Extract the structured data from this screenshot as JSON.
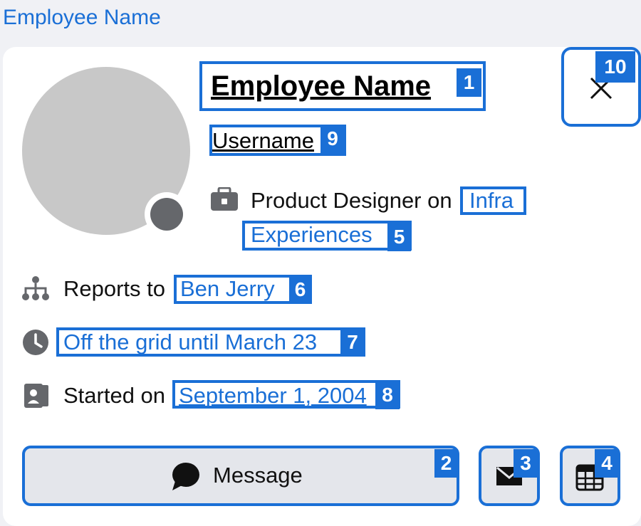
{
  "header": {
    "title_link": "Employee Name"
  },
  "profile": {
    "name": "Employee Name",
    "username": "Username",
    "role_prefix": "Product Designer on",
    "team_line1": "Infra",
    "team_line2": "Experiences",
    "reports_to_label": "Reports to",
    "manager": "Ben Jerry",
    "status": "Off the grid until March 23",
    "started_label": "Started on",
    "start_date": "September 1, 2004"
  },
  "actions": {
    "message_label": "Message"
  },
  "markers": {
    "name": "1",
    "message": "2",
    "email": "3",
    "calendar": "4",
    "team": "5",
    "manager": "6",
    "status": "7",
    "start_date": "8",
    "username": "9",
    "close": "10"
  },
  "colors": {
    "accent": "#1a6fd6",
    "avatar": "#c8c8c8",
    "presence": "#65676b",
    "button_bg": "#e4e6eb"
  },
  "icons": [
    "briefcase-icon",
    "org-chart-icon",
    "clock-icon",
    "badge-icon",
    "chat-bubble-icon",
    "envelope-icon",
    "calendar-icon",
    "close-icon"
  ]
}
